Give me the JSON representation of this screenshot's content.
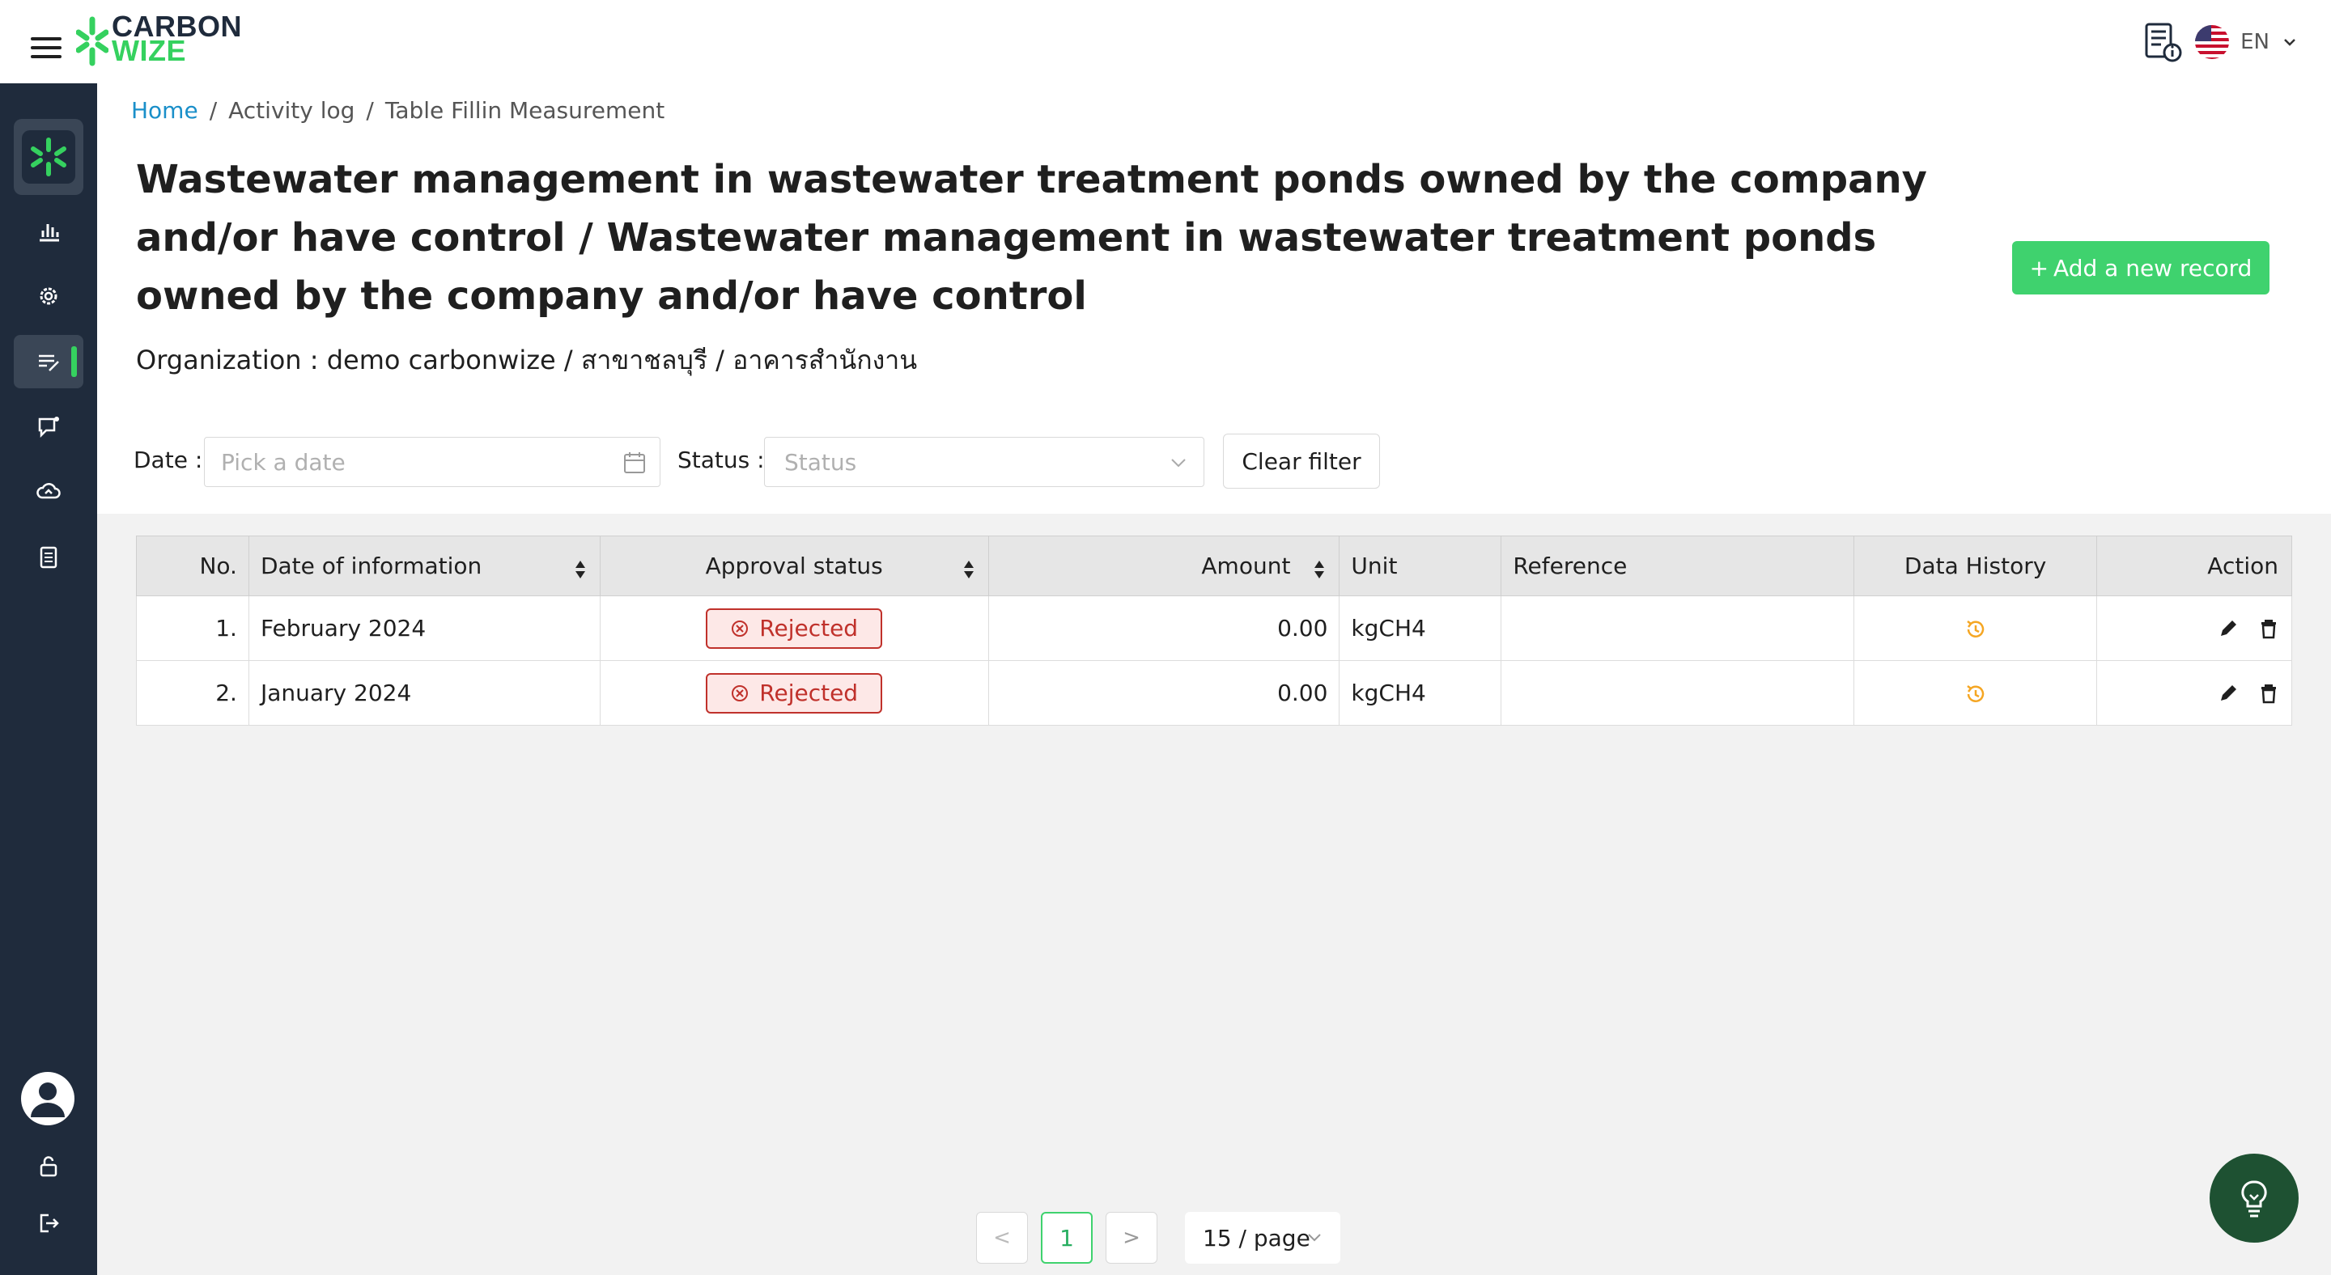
{
  "header": {
    "logo_line1": "CARBON",
    "logo_line2": "WIZE",
    "language": "EN"
  },
  "breadcrumb": {
    "home": "Home",
    "sep": "/",
    "activity_log": "Activity log",
    "current": "Table Fillin Measurement"
  },
  "page": {
    "title": "Wastewater management in wastewater treatment ponds owned by the company and/or have control / Wastewater management in wastewater treatment ponds owned by the company and/or have control",
    "organization": "Organization : demo carbonwize / สาขาชลบุรี / อาคารสำนักงาน",
    "add_button": "Add a new record",
    "add_button_prefix": "+"
  },
  "filters": {
    "date_label": "Date :",
    "date_placeholder": "Pick a date",
    "status_label": "Status :",
    "status_placeholder": "Status",
    "clear_button": "Clear filter"
  },
  "table": {
    "headers": {
      "no": "No.",
      "date": "Date of information",
      "approval": "Approval status",
      "amount": "Amount",
      "unit": "Unit",
      "reference": "Reference",
      "history": "Data History",
      "action": "Action"
    },
    "rows": [
      {
        "no": "1.",
        "date": "February 2024",
        "status": "Rejected",
        "amount": "0.00",
        "unit": "kgCH4",
        "reference": ""
      },
      {
        "no": "2.",
        "date": "January 2024",
        "status": "Rejected",
        "amount": "0.00",
        "unit": "kgCH4",
        "reference": ""
      }
    ]
  },
  "pagination": {
    "prev": "<",
    "current_page": "1",
    "next": ">",
    "page_size": "15 / page"
  },
  "colors": {
    "sidebar_bg": "#1f2b3c",
    "accent_green": "#3fd26e",
    "rejected_red": "#c0312b",
    "history_orange": "#f5a623",
    "link_blue": "#1a8fc9"
  }
}
